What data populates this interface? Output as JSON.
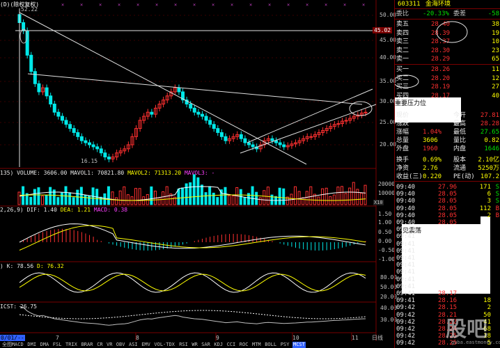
{
  "header": {
    "code": "603311",
    "name": "金海环境",
    "top_left_label": "(D)(除权复权)"
  },
  "price_axis": [
    "50.00",
    "45.00",
    "40.00",
    "35.00",
    "30.00",
    "25.00",
    "20.00"
  ],
  "price_axis_marker": "45.02",
  "peak_label": "52.22",
  "low_label": "16.15",
  "volume_axis": [
    "20000",
    "10000"
  ],
  "volume_axis_unit": "X10",
  "macd_axis": [
    "1.50",
    "1.00",
    "0.50",
    "0.00",
    "-0.50",
    "-1.00"
  ],
  "kdj_axis": [
    "80.00",
    "50.00",
    "20.00"
  ],
  "cost_axis": [
    "40.00",
    "30.00"
  ],
  "indicators": {
    "volume_prefix": "135)",
    "volume": "VOLUME: 3606.00",
    "mavol1": "MAVOL1: 70821.80",
    "mavol2": "MAVOL2: 71313.20",
    "mavol3": "MAVOL3: -",
    "macd_prefix": "2,26,9)",
    "dif": "DIF: 1.40",
    "dea": "DEA: 1.21",
    "macd": "MACD: 0.38",
    "kdj_prefix": ")",
    "k": "K: 78.56",
    "d": "D: 76.32",
    "cost_label": "ICST: 26.75"
  },
  "time_axis": [
    "7",
    "8",
    "9",
    "10",
    "11"
  ],
  "time_axis_year": "0/01/--",
  "bottom_tabs": [
    "全图",
    "MACD",
    "DMI",
    "DMA",
    "FSL",
    "TRIX",
    "BRAR",
    "CR",
    "VR",
    "OBV",
    "ASI",
    "EMV",
    "VOL-TDX",
    "RSI",
    "WR",
    "SAR",
    "KDJ",
    "CCI",
    "ROC",
    "MTM",
    "BOLL",
    "PSY",
    "MCST"
  ],
  "bottom_right_label": "日线",
  "popup_top": "重要压力位",
  "popup_mid": "震荡",
  "popup_mid_prefix": "见",
  "quote": {
    "weibi_label": "委比",
    "weibi_value": "-20.33%",
    "weicha_label": "委差",
    "weicha_value": "-58",
    "sells": [
      {
        "label": "卖五",
        "price": "28.40",
        "vol": "38"
      },
      {
        "label": "卖四",
        "price": "28.39",
        "vol": "19"
      },
      {
        "label": "卖三",
        "price": "28.37",
        "vol": "10"
      },
      {
        "label": "卖二",
        "price": "28.30",
        "vol": "23"
      },
      {
        "label": "卖一",
        "price": "28.29",
        "vol": "65"
      }
    ],
    "buys": [
      {
        "label": "买一",
        "price": "28.26",
        "vol": "11"
      },
      {
        "label": "买二",
        "price": "28.20",
        "vol": "12"
      },
      {
        "label": "买三",
        "price": "28.19",
        "vol": "27"
      },
      {
        "label": "买四",
        "price": "28.17",
        "vol": "40"
      }
    ],
    "stats_left": [
      {
        "label": "现价",
        "value": "",
        "cls": "red"
      },
      {
        "label": "涨跌",
        "value": "",
        "cls": "red"
      },
      {
        "label": "涨幅",
        "value": "1.04%",
        "cls": "red"
      },
      {
        "label": "总量",
        "value": "3606",
        "cls": "yel"
      },
      {
        "label": "外盘",
        "value": "1960",
        "cls": "red"
      },
      {
        "label": "换手",
        "value": "0.69%",
        "cls": "yel"
      },
      {
        "label": "净资",
        "value": "2.76",
        "cls": "yel"
      },
      {
        "label": "收益(三)",
        "value": "0.220",
        "cls": "yel"
      }
    ],
    "stats_right": [
      {
        "label": "今开",
        "value": "27.81",
        "cls": "red"
      },
      {
        "label": "最高",
        "value": "28.28",
        "cls": "red"
      },
      {
        "label": "最低",
        "value": "27.65",
        "cls": "grn"
      },
      {
        "label": "量比",
        "value": "0.82",
        "cls": "yel"
      },
      {
        "label": "内盘",
        "value": "1646",
        "cls": "grn"
      },
      {
        "label": "股本",
        "value": "2.10亿",
        "cls": "yel"
      },
      {
        "label": "流通",
        "value": "5250万",
        "cls": "yel"
      },
      {
        "label": "PE(动)",
        "value": "107.2",
        "cls": "yel"
      }
    ],
    "ticks": [
      {
        "time": "09:40",
        "price": "27.96",
        "vol": "171",
        "side": "S",
        "pcls": "red",
        "scls": "grn"
      },
      {
        "time": "09:40",
        "price": "28.05",
        "vol": "6",
        "side": "S",
        "pcls": "red",
        "scls": "grn"
      },
      {
        "time": "09:40",
        "price": "28.05",
        "vol": "3",
        "side": "S",
        "pcls": "red",
        "scls": "grn"
      },
      {
        "time": "09:40",
        "price": "28.05",
        "vol": "112",
        "side": "B",
        "pcls": "red",
        "scls": "red"
      },
      {
        "time": "09:40",
        "price": "28.05",
        "vol": "2",
        "side": "B",
        "pcls": "red",
        "scls": "red"
      },
      {
        "time": "09:40",
        "price": "28.05",
        "vol": "",
        "side": "",
        "pcls": "red",
        "scls": "red"
      },
      {
        "time": "09:41",
        "price": "",
        "vol": "",
        "side": "",
        "pcls": "red",
        "scls": "red"
      },
      {
        "time": "09:41",
        "price": "",
        "vol": "",
        "side": "",
        "pcls": "red",
        "scls": "red"
      },
      {
        "time": "09:41",
        "price": "",
        "vol": "",
        "side": "",
        "pcls": "red",
        "scls": "red"
      },
      {
        "time": "09:41",
        "price": "",
        "vol": "",
        "side": "",
        "pcls": "red",
        "scls": "red"
      },
      {
        "time": "09:41",
        "price": "",
        "vol": "",
        "side": "",
        "pcls": "red",
        "scls": "red"
      },
      {
        "time": "09:41",
        "price": "",
        "vol": "",
        "side": "",
        "pcls": "red",
        "scls": "red"
      },
      {
        "time": "09:41",
        "price": "",
        "vol": "",
        "side": "",
        "pcls": "red",
        "scls": "red"
      },
      {
        "time": "09:41",
        "price": "",
        "vol": "",
        "side": "",
        "pcls": "red",
        "scls": "red"
      },
      {
        "time": "09:41",
        "price": "",
        "vol": "",
        "side": "",
        "pcls": "red",
        "scls": "red"
      },
      {
        "time": "09:41",
        "price": "28.17",
        "vol": "",
        "side": "",
        "pcls": "red",
        "scls": "red"
      },
      {
        "time": "09:41",
        "price": "28.16",
        "vol": "",
        "side": "",
        "pcls": "red",
        "scls": "red"
      },
      {
        "time": "09:42",
        "price": "28.15",
        "vol": "",
        "side": "",
        "pcls": "red",
        "scls": "red"
      },
      {
        "time": "09:42",
        "price": "28.21",
        "vol": "",
        "side": "",
        "pcls": "red",
        "scls": "red"
      },
      {
        "time": "09:42",
        "price": "28.22",
        "vol": "",
        "side": "",
        "pcls": "red",
        "scls": "red"
      },
      {
        "time": "09:42",
        "price": "28.24",
        "vol": "",
        "side": "",
        "pcls": "red",
        "scls": "red"
      },
      {
        "time": "09:42",
        "price": "28.25",
        "vol": "",
        "side": "",
        "pcls": "red",
        "scls": "red"
      },
      {
        "time": "09:42",
        "price": "28.25",
        "vol": "",
        "side": "",
        "pcls": "red",
        "scls": "red"
      }
    ],
    "tick_vols_tail": [
      "18",
      "2",
      "50",
      "41",
      "68",
      "18",
      "5"
    ]
  },
  "watermark": "股吧",
  "watermark_sub": "guba.eastmoney.com"
}
